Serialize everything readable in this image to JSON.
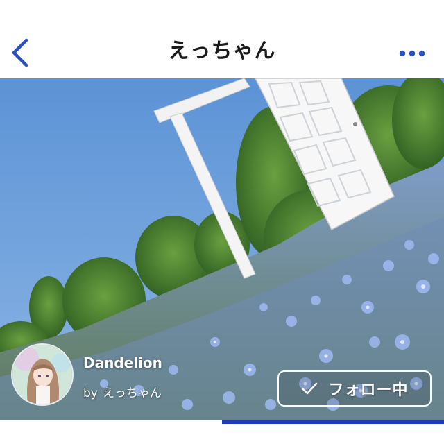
{
  "header": {
    "title": "えっちゃん",
    "back_icon": "chevron-left-icon",
    "more_icon": "more-horizontal-icon"
  },
  "album": {
    "title": "Dandelion",
    "by_prefix": "by",
    "author": "えっちゃん"
  },
  "follow_button": {
    "label": "フォロー中",
    "icon": "check-icon"
  },
  "colors": {
    "accent": "#1a3fb0",
    "header_bg": "#ffffff",
    "title_text": "#1a1a1a"
  }
}
